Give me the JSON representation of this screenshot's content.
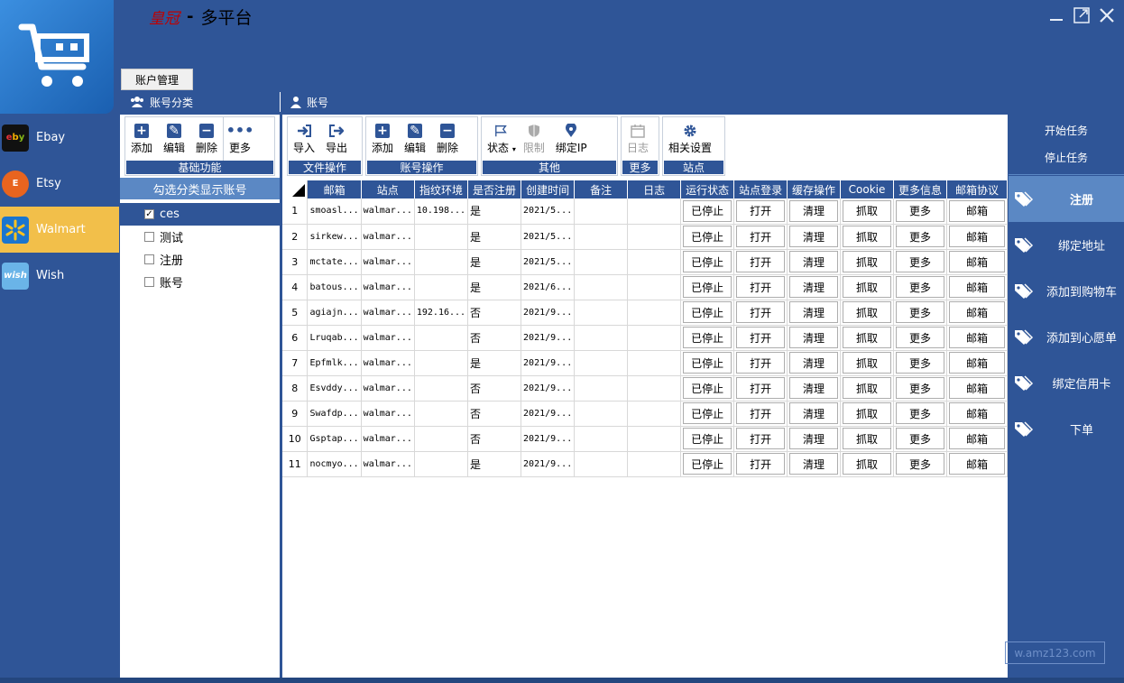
{
  "header": {
    "brand": "皇冠",
    "dash": "-",
    "app_name": "多平台",
    "tab_account_mgmt": "账户管理",
    "section_category": "账号分类",
    "section_account": "账号"
  },
  "platforms": [
    {
      "label": "Ebay",
      "active": false
    },
    {
      "label": "Etsy",
      "active": false
    },
    {
      "label": "Walmart",
      "active": true
    },
    {
      "label": "Wish",
      "active": false
    }
  ],
  "category_toolbar": {
    "add": "添加",
    "edit": "编辑",
    "delete": "删除",
    "more": "更多",
    "group_label": "基础功能"
  },
  "account_toolbar": {
    "file_ops": {
      "import": "导入",
      "export": "导出",
      "group_label": "文件操作"
    },
    "account_ops": {
      "add": "添加",
      "edit": "编辑",
      "delete": "删除",
      "group_label": "账号操作"
    },
    "other": {
      "status": "状态",
      "limit": "限制",
      "bind_ip": "绑定IP",
      "group_label": "其他"
    },
    "more": {
      "log": "日志",
      "group_label": "更多"
    },
    "site": {
      "settings": "相关设置",
      "group_label": "站点"
    }
  },
  "category_panel": {
    "header": "勾选分类显示账号",
    "items": [
      {
        "label": "ces",
        "checked": true
      },
      {
        "label": "测试",
        "checked": false
      },
      {
        "label": "注册",
        "checked": false
      },
      {
        "label": "账号",
        "checked": false
      }
    ]
  },
  "grid": {
    "columns": [
      "邮箱",
      "站点",
      "指纹环境",
      "是否注册",
      "创建时间",
      "备注",
      "日志",
      "运行状态",
      "站点登录",
      "缓存操作",
      "Cookie",
      "更多信息",
      "邮箱协议"
    ],
    "button_labels": {
      "status": "已停止",
      "login": "打开",
      "cache": "清理",
      "cookie": "抓取",
      "more": "更多",
      "mail": "邮箱"
    },
    "rows": [
      {
        "n": "1",
        "email": "smoasl...",
        "site": "walmar...",
        "env": "10.198...",
        "reg": "是",
        "created": "2021/5..."
      },
      {
        "n": "2",
        "email": "sirkew...",
        "site": "walmar...",
        "env": "",
        "reg": "是",
        "created": "2021/5..."
      },
      {
        "n": "3",
        "email": "mctate...",
        "site": "walmar...",
        "env": "",
        "reg": "是",
        "created": "2021/5..."
      },
      {
        "n": "4",
        "email": "batous...",
        "site": "walmar...",
        "env": "",
        "reg": "是",
        "created": "2021/6..."
      },
      {
        "n": "5",
        "email": "agiajn...",
        "site": "walmar...",
        "env": "192.16...",
        "reg": "否",
        "created": "2021/9..."
      },
      {
        "n": "6",
        "email": "Lruqab...",
        "site": "walmar...",
        "env": "",
        "reg": "否",
        "created": "2021/9..."
      },
      {
        "n": "7",
        "email": "Epfmlk...",
        "site": "walmar...",
        "env": "",
        "reg": "是",
        "created": "2021/9..."
      },
      {
        "n": "8",
        "email": "Esvddy...",
        "site": "walmar...",
        "env": "",
        "reg": "否",
        "created": "2021/9..."
      },
      {
        "n": "9",
        "email": "Swafdp...",
        "site": "walmar...",
        "env": "",
        "reg": "否",
        "created": "2021/9..."
      },
      {
        "n": "10",
        "email": "Gsptap...",
        "site": "walmar...",
        "env": "",
        "reg": "否",
        "created": "2021/9..."
      },
      {
        "n": "11",
        "email": "nocmyo...",
        "site": "walmar...",
        "env": "",
        "reg": "是",
        "created": "2021/9..."
      }
    ]
  },
  "tasks": {
    "start": "开始任务",
    "stop": "停止任务",
    "flows": [
      {
        "label": "注册",
        "active": true
      },
      {
        "label": "绑定地址",
        "active": false
      },
      {
        "label": "添加到购物车",
        "active": false
      },
      {
        "label": "添加到心愿单",
        "active": false
      },
      {
        "label": "绑定信用卡",
        "active": false
      },
      {
        "label": "下单",
        "active": false
      }
    ]
  },
  "watermark": "w.amz123.com",
  "colors": {
    "primary": "#2f5597",
    "accent": "#f2bf4a",
    "highlight": "#5b88c4",
    "brand_red": "#c00000"
  }
}
